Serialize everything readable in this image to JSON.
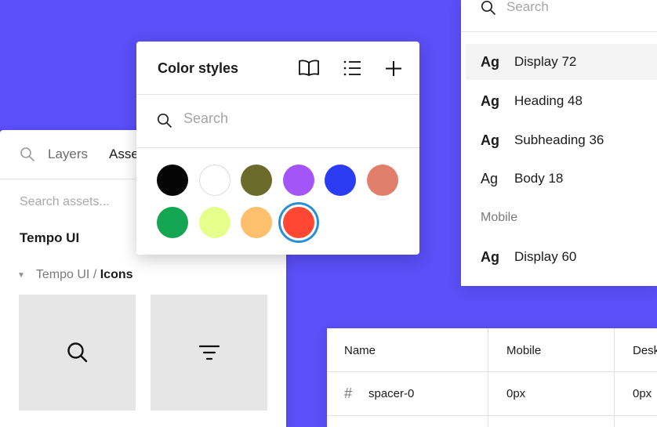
{
  "assets_panel": {
    "tabs": [
      {
        "label": "Layers",
        "active": false
      },
      {
        "label": "Assets",
        "active": true
      }
    ],
    "search_placeholder": "Search assets...",
    "library_title": "Tempo UI",
    "breadcrumb": {
      "parent": "Tempo UI /",
      "current": "Icons"
    },
    "tiles": [
      {
        "icon": "search-icon"
      },
      {
        "icon": "filter-icon"
      }
    ]
  },
  "color_styles": {
    "title": "Color styles",
    "search_placeholder": "Search",
    "swatches": [
      {
        "color": "#050505"
      },
      {
        "color": "#ffffff"
      },
      {
        "color": "#6a6a2a"
      },
      {
        "color": "#a355f7"
      },
      {
        "color": "#2c3cf5"
      },
      {
        "color": "#e0806c"
      },
      {
        "color": "#14a653"
      },
      {
        "color": "#e4ff8c"
      },
      {
        "color": "#fec06d"
      },
      {
        "color": "#ff4733",
        "selected": true
      }
    ],
    "icons": [
      "book-icon",
      "list-icon",
      "plus-icon"
    ]
  },
  "text_styles": {
    "search_placeholder": "Search",
    "items": [
      {
        "ag": "Ag",
        "label": "Display 72"
      },
      {
        "ag": "Ag",
        "label": "Heading 48"
      },
      {
        "ag": "Ag",
        "label": "Subheading 36"
      },
      {
        "ag": "Ag",
        "label": "Body 18"
      }
    ],
    "section": "Mobile",
    "mobile_items": [
      {
        "ag": "Ag",
        "label": "Display 60"
      }
    ]
  },
  "spacing_table": {
    "headers": [
      "Name",
      "Mobile",
      "Desk"
    ],
    "rows": [
      {
        "symbol": "#",
        "name": "spacer-0",
        "mobile": "0px",
        "desktop": "0px"
      }
    ]
  },
  "colors": {
    "background": "#5a4ff8",
    "selection_ring": "#2b8fd3"
  }
}
